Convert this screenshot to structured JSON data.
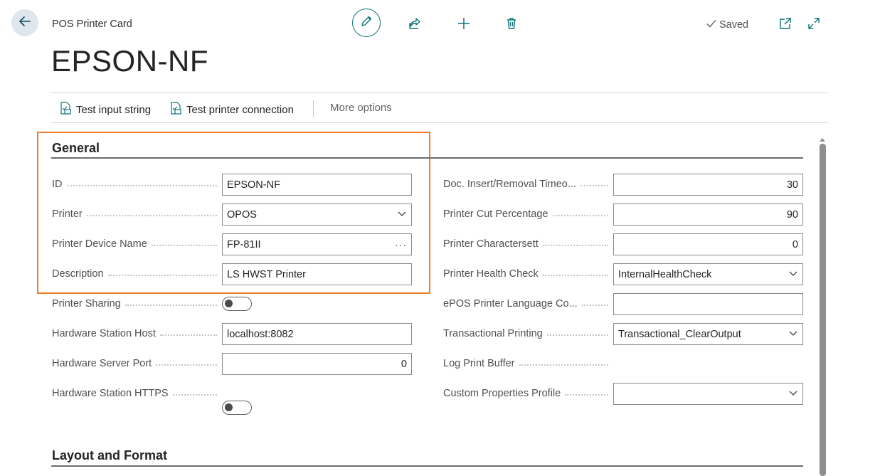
{
  "header": {
    "breadcrumb": "POS Printer Card",
    "title": "EPSON-NF",
    "status": "Saved",
    "icons": [
      "back-arrow-icon",
      "edit-pencil-icon",
      "share-icon",
      "plus-icon",
      "trash-icon",
      "open-new-window-icon",
      "expand-icon"
    ]
  },
  "actions": {
    "test_input": "Test input string",
    "test_connection": "Test printer connection",
    "more_options": "More options"
  },
  "general": {
    "title": "General",
    "left": {
      "id": {
        "label": "ID",
        "value": "EPSON-NF"
      },
      "printer": {
        "label": "Printer",
        "value": "OPOS"
      },
      "device_name": {
        "label": "Printer Device Name",
        "value": "FP-81II"
      },
      "description": {
        "label": "Description",
        "value": "LS HWST Printer"
      },
      "sharing": {
        "label": "Printer Sharing",
        "value": "off"
      },
      "hw_host": {
        "label": "Hardware Station Host",
        "value": "localhost:8082"
      },
      "hw_port": {
        "label": "Hardware Server Port",
        "value": "0"
      },
      "hw_https": {
        "label": "Hardware Station HTTPS",
        "value": "off"
      }
    },
    "right": {
      "doc_timeout": {
        "label": "Doc. Insert/Removal Timeo...",
        "value": "30"
      },
      "cut_pct": {
        "label": "Printer Cut Percentage",
        "value": "90"
      },
      "charset": {
        "label": "Printer Charactersett",
        "value": "0"
      },
      "health": {
        "label": "Printer Health Check",
        "value": "InternalHealthCheck"
      },
      "epos_lang": {
        "label": "ePOS Printer Language Co...",
        "value": ""
      },
      "transactional": {
        "label": "Transactional Printing",
        "value": "Transactional_ClearOutput"
      },
      "log_buffer": {
        "label": "Log Print Buffer",
        "value": "off"
      },
      "custom_profile": {
        "label": "Custom Properties Profile",
        "value": ""
      }
    }
  },
  "layout_section": {
    "title": "Layout and Format"
  },
  "colors": {
    "accent": "#0f7478",
    "highlight": "#ef7f2c"
  }
}
